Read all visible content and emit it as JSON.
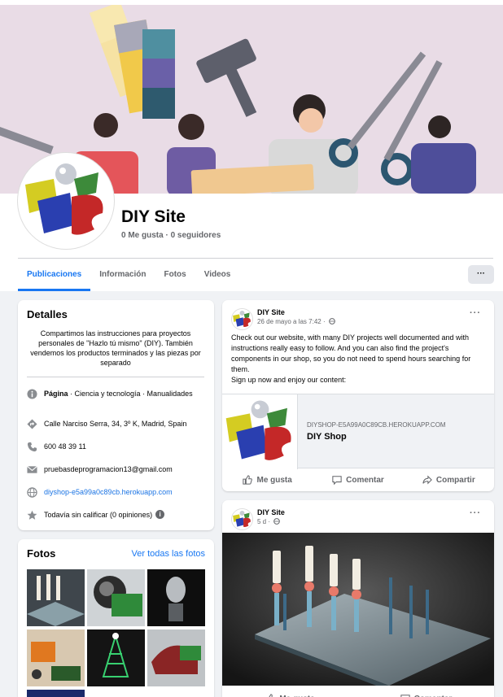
{
  "page": {
    "name": "DIY Site",
    "stats": "0 Me gusta · 0 seguidores"
  },
  "tabs": [
    "Publicaciones",
    "Información",
    "Fotos",
    "Videos"
  ],
  "more_label": "···",
  "details": {
    "title": "Detalles",
    "about": "Compartimos las instrucciones para proyectos personales de \"Hazlo tú mismo\" (DIY). También vendemos los productos terminados y las piezas por separado",
    "category_label": "Página",
    "category_value": " · Ciencia y tecnología · Manualidades",
    "address": "Calle Narciso Serra, 34, 3º K, Madrid, Spain",
    "phone": "600 48 39 11",
    "email": "pruebasdeprogramacion13@gmail.com",
    "website": "diyshop-e5a99a0c89cb.herokuapp.com",
    "rating": "Todavía sin calificar (0 opiniones)"
  },
  "photos": {
    "title": "Fotos",
    "see_all": "Ver todas las fotos"
  },
  "post1": {
    "author": "DIY Site",
    "time": "26 de mayo a las 7:42 ·",
    "text_1": "Check out our website, with many DIY projects well documented and with instructions really easy to follow. And you can also find  the project's components in our shop, so you do not need to spend hours searching for them.",
    "text_2": "Sign up now  and enjoy our content:",
    "link_domain": "DIYSHOP-E5A99A0C89CB.HEROKUAPP.COM",
    "link_title": "DIY Shop"
  },
  "post2": {
    "author": "DIY Site",
    "time": "5 d ·"
  },
  "actions": {
    "like": "Me gusta",
    "comment": "Comentar",
    "share": "Compartir"
  },
  "colors": {
    "accent": "#1877f2",
    "cover_bg": "#e9dce6",
    "page_bg": "#f0f2f5"
  }
}
